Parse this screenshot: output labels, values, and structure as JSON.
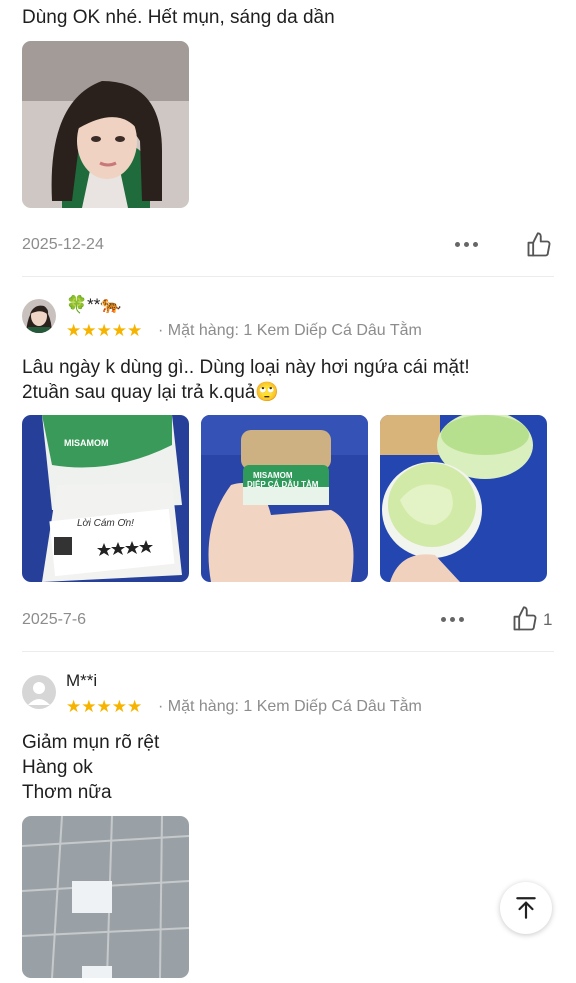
{
  "reviews": [
    {
      "text_lines": [
        "Dùng OK nhé. Hết mụn, sáng da dần"
      ],
      "date": "2025-12-24",
      "like_count": ""
    },
    {
      "username": "🍀**🐅",
      "stars": "★★★★★",
      "product": "· Mặt hàng: 1 Kem Diếp Cá Dâu Tằm",
      "text_lines": [
        "Lâu ngày k dùng gì..  Dùng loại này hơi ngứa cái mặt!",
        "2tuần sau quay lại trả k.quả🙄"
      ],
      "image_texts": {
        "brand": "MISAMOM",
        "card_title": "Lời Cám Ơn!",
        "jar_label": "DIẾP CÁ DÂU TẰM"
      },
      "date": "2025-7-6",
      "like_count": "1"
    },
    {
      "username": "M**i",
      "stars": "★★★★★",
      "product": "· Mặt hàng: 1 Kem Diếp Cá Dâu Tằm",
      "text_lines": [
        "Giảm mụn rõ rệt",
        "Hàng ok",
        "Thơm nữa"
      ]
    }
  ],
  "icons": {
    "more": "more-horizontal-icon",
    "like": "thumbs-up-icon",
    "back_to_top": "arrow-up-to-top-icon"
  },
  "colors": {
    "star": "#f6b400",
    "muted": "#8c8c8c"
  }
}
